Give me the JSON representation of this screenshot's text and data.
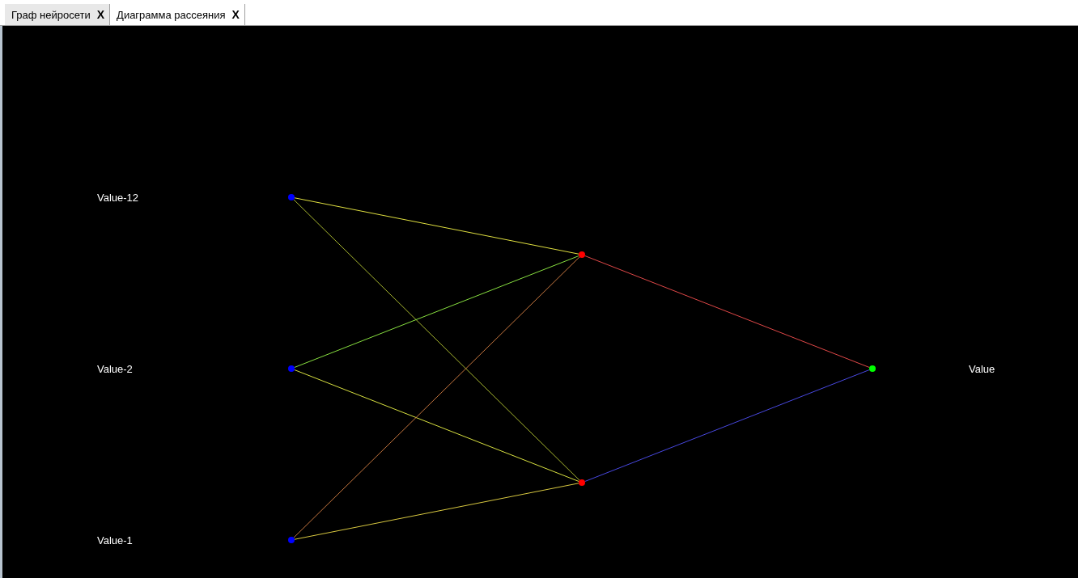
{
  "tabs": [
    {
      "label": "Граф нейросети",
      "close": "X",
      "selected": false
    },
    {
      "label": "Диаграмма рассеяния",
      "close": "X",
      "selected": true
    }
  ],
  "network": {
    "layers": [
      {
        "nodes": [
          {
            "label": "Value-12",
            "color": "#0000ff",
            "links": [
              {
                "color": "#e0e040"
              },
              {
                "color": "#a8b830"
              }
            ]
          },
          {
            "label": "Value-2",
            "color": "#0000ff",
            "links": [
              {
                "color": "#88e040"
              },
              {
                "color": "#d8e040"
              }
            ]
          },
          {
            "label": "Value-1",
            "color": "#0000ff",
            "links": [
              {
                "color": "#c87840"
              },
              {
                "color": "#d8c840"
              }
            ]
          }
        ]
      },
      {
        "nodes": [
          {
            "color": "#ff0000",
            "links": [
              {
                "color": "#e04848"
              }
            ]
          },
          {
            "color": "#ff0000",
            "links": [
              {
                "color": "#4848e0"
              }
            ]
          }
        ]
      },
      {
        "nodes": [
          {
            "label": "Value",
            "color": "#00ff00"
          }
        ]
      }
    ]
  }
}
